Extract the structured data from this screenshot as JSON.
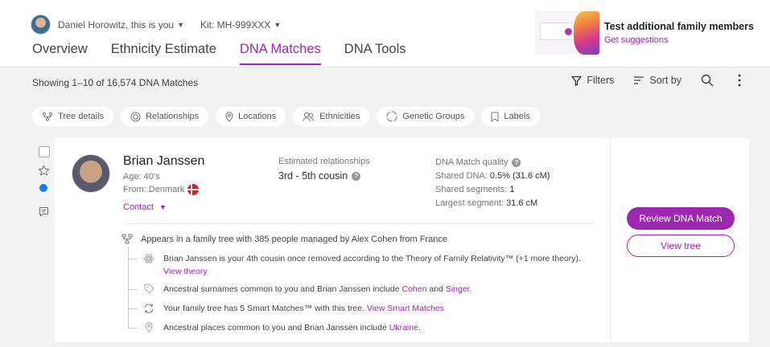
{
  "header": {
    "user_label": "Daniel Horowitz, this is you",
    "kit_label": "Kit: MH-999XXX",
    "tabs": [
      "Overview",
      "Ethnicity Estimate",
      "DNA Matches",
      "DNA Tools"
    ],
    "active_tab": "DNA Matches",
    "promo": {
      "title": "Test additional family members",
      "link": "Get suggestions"
    }
  },
  "toolbar": {
    "summary": "Showing 1–10 of 16,574 DNA Matches",
    "filters_label": "Filters",
    "sort_label": "Sort by"
  },
  "chips": [
    "Tree details",
    "Relationships",
    "Locations",
    "Ethnicities",
    "Genetic Groups",
    "Labels"
  ],
  "match": {
    "name": "Brian Janssen",
    "age": "Age: 40's",
    "from_label": "From:",
    "from_value": "Denmark",
    "contact_label": "Contact",
    "estimated_label": "Estimated relationships",
    "estimated_value": "3rd - 5th cousin",
    "quality_label": "DNA Match quality",
    "shared_dna_label": "Shared DNA:",
    "shared_dna_value": "0.5% (31.6 cM)",
    "shared_segments_label": "Shared segments:",
    "shared_segments_value": "1",
    "largest_segment_label": "Largest segment:",
    "largest_segment_value": "31.6 cM",
    "review_button": "Review DNA Match",
    "view_tree_button": "View tree",
    "tree_summary": "Appears in a family tree with 385 people managed by Alex Cohen from France",
    "insights": {
      "theory_text": "Brian Janssen is your 4th cousin once removed according to the Theory of Family Relativity™ (+1 more theory).",
      "theory_link": "View theory",
      "surnames_text": "Ancestral surnames common to you and Brian Janssen include",
      "surname_1": "Cohen",
      "surnames_and": "and",
      "surname_2": "Singer",
      "surnames_end": ".",
      "smart_text": "Your family tree has 5 Smart Matches™ with this tree.",
      "smart_link": "View Smart Matches",
      "places_text": "Ancestral places common to you and Brian Janssen include",
      "place_1": "Ukraine",
      "places_end": "."
    }
  },
  "colors": {
    "accent": "#9c27b0",
    "dot": "#1a7ee6",
    "background": "#f2f2f2"
  }
}
